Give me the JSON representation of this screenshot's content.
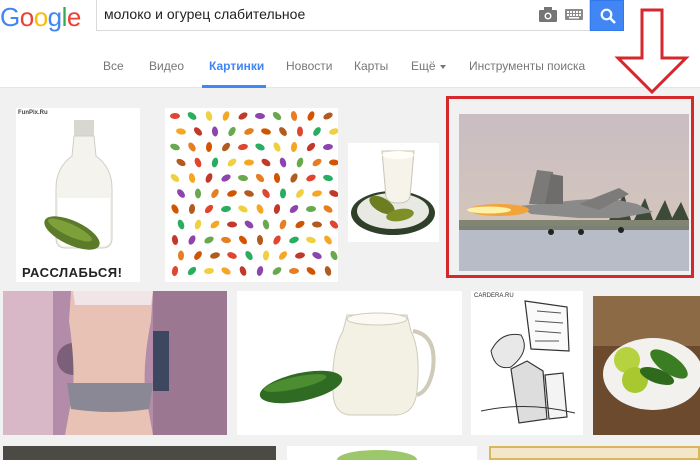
{
  "logo": {
    "letters": [
      "G",
      "o",
      "o",
      "g",
      "l",
      "e"
    ],
    "colors": [
      "#4285f4",
      "#ea4335",
      "#fbbc05",
      "#4285f4",
      "#34a853",
      "#ea4335"
    ]
  },
  "search": {
    "query": "молоко и огурец слабительное"
  },
  "tabs": [
    {
      "label": "Все",
      "active": false
    },
    {
      "label": "Видео",
      "active": false
    },
    {
      "label": "Картинки",
      "active": true
    },
    {
      "label": "Новости",
      "active": false
    },
    {
      "label": "Карты",
      "active": false
    },
    {
      "label": "Ещё",
      "active": false
    },
    {
      "label": "Инструменты поиска",
      "active": false
    }
  ],
  "results": {
    "r1": {
      "watermark": "FunPix.Ru",
      "caption": "РАССЛАБЬСЯ!"
    },
    "r7": {
      "header": "CARDERA.RU"
    }
  },
  "annotation": {
    "color": "#d4282d"
  }
}
